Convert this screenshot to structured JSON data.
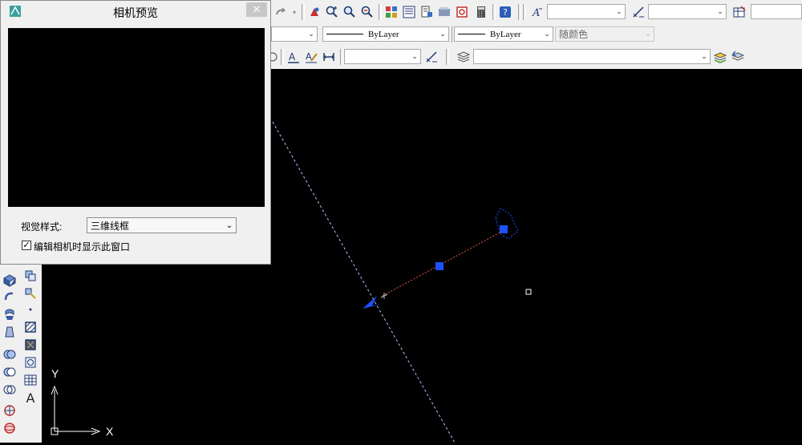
{
  "dialog": {
    "title": "相机预览",
    "close_glyph": "✕",
    "visual_style_label": "视觉样式:",
    "visual_style_value": "三维线框",
    "checkbox_label": "编辑相机时显示此窗口",
    "checkbox_checked": true
  },
  "toolbar": {
    "linetype_value": "ByLayer",
    "lineweight_value": "ByLayer",
    "color_value": "随颜色"
  },
  "ucs": {
    "y_label": "Y",
    "x_label": "X"
  },
  "left_toolbar": {
    "text_tool_label": "A"
  },
  "colors": {
    "ui_bg": "#f0f0f0",
    "canvas_bg": "#000000",
    "grip_blue": "#1e50ff",
    "camera_line": "#e06040",
    "clip_line": "#a9c8ff"
  },
  "icons": [
    "zoom-realtime-icon",
    "zoom-window-icon",
    "zoom-previous-icon",
    "properties-icon",
    "design-center-icon",
    "calculator-icon",
    "help-icon",
    "text-style-icon",
    "dim-style-icon",
    "layers-icon",
    "camera-icon"
  ]
}
